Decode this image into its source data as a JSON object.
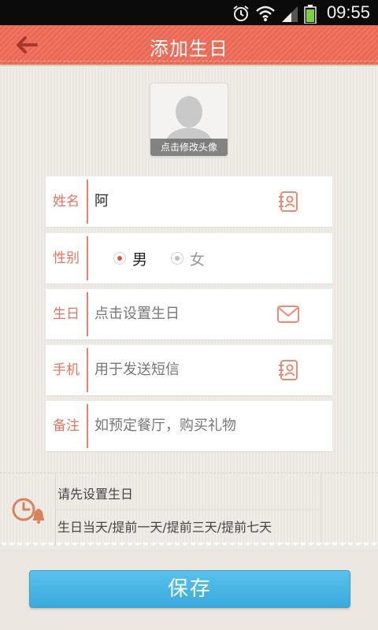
{
  "statusbar": {
    "time": "09:55"
  },
  "header": {
    "title": "添加生日"
  },
  "avatar": {
    "caption": "点击修改头像"
  },
  "form": {
    "name": {
      "label": "姓名",
      "value": "阿"
    },
    "gender": {
      "label": "性别",
      "options": [
        "男",
        "女"
      ],
      "selected": "男"
    },
    "birthday": {
      "label": "生日",
      "placeholder": "点击设置生日"
    },
    "phone": {
      "label": "手机",
      "placeholder": "用于发送短信"
    },
    "note": {
      "label": "备注",
      "placeholder": "如预定餐厅，购买礼物"
    }
  },
  "reminder": {
    "prompt": "请先设置生日",
    "options_text": "生日当天/提前一天/提前三天/提前七天"
  },
  "save_label": "保存",
  "colors": {
    "accent": "#ef6b57",
    "button": "#4bb6e6"
  }
}
